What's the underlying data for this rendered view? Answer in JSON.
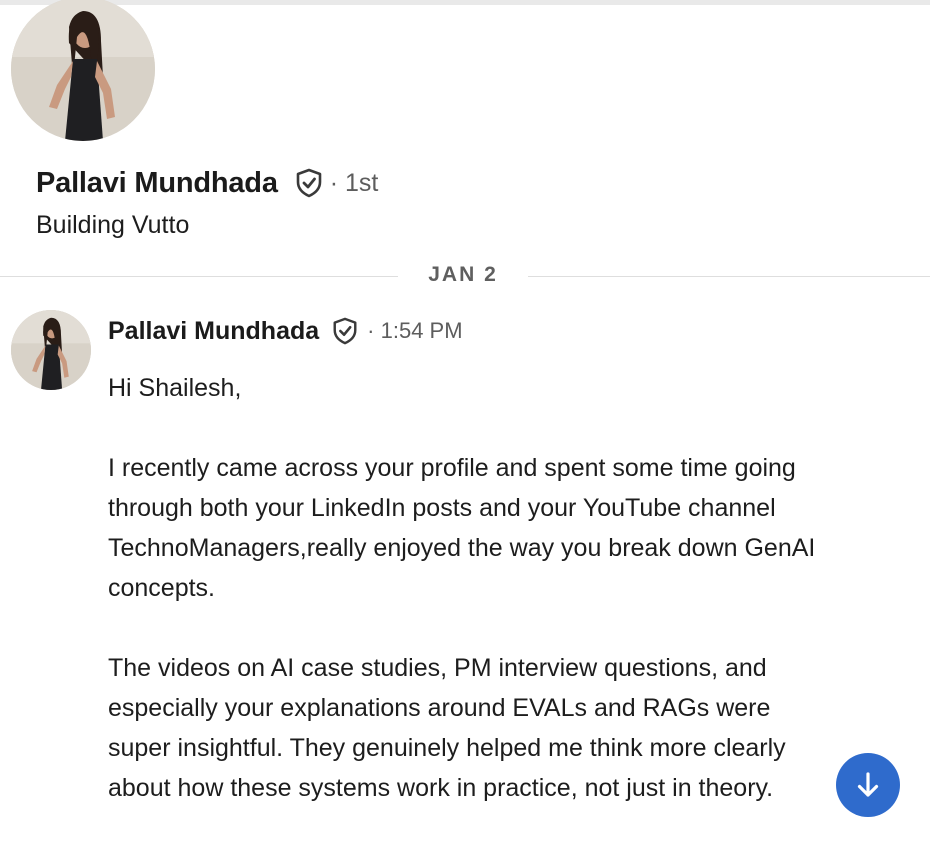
{
  "profile": {
    "name": "Pallavi Mundhada",
    "degree": "· 1st",
    "headline": "Building Vutto"
  },
  "date_separator": "JAN 2",
  "message": {
    "sender": "Pallavi Mundhada",
    "time": "· 1:54 PM",
    "paragraphs": [
      "Hi Shailesh,",
      "I recently came across your profile and spent some time going through both your LinkedIn posts and your YouTube channel TechnoManagers,really enjoyed the way you break down GenAI concepts.",
      "The videos on AI case studies, PM interview questions, and especially your explanations around EVALs and RAGs were super insightful. They genuinely helped me think more clearly about how these systems work in practice, not just in theory."
    ]
  },
  "icons": {
    "verified": "verified-shield-icon",
    "scroll_down": "arrow-down-icon"
  },
  "colors": {
    "accent": "#2f6bcc",
    "divider": "#dedede",
    "secondary_text": "#5d5d5d"
  }
}
